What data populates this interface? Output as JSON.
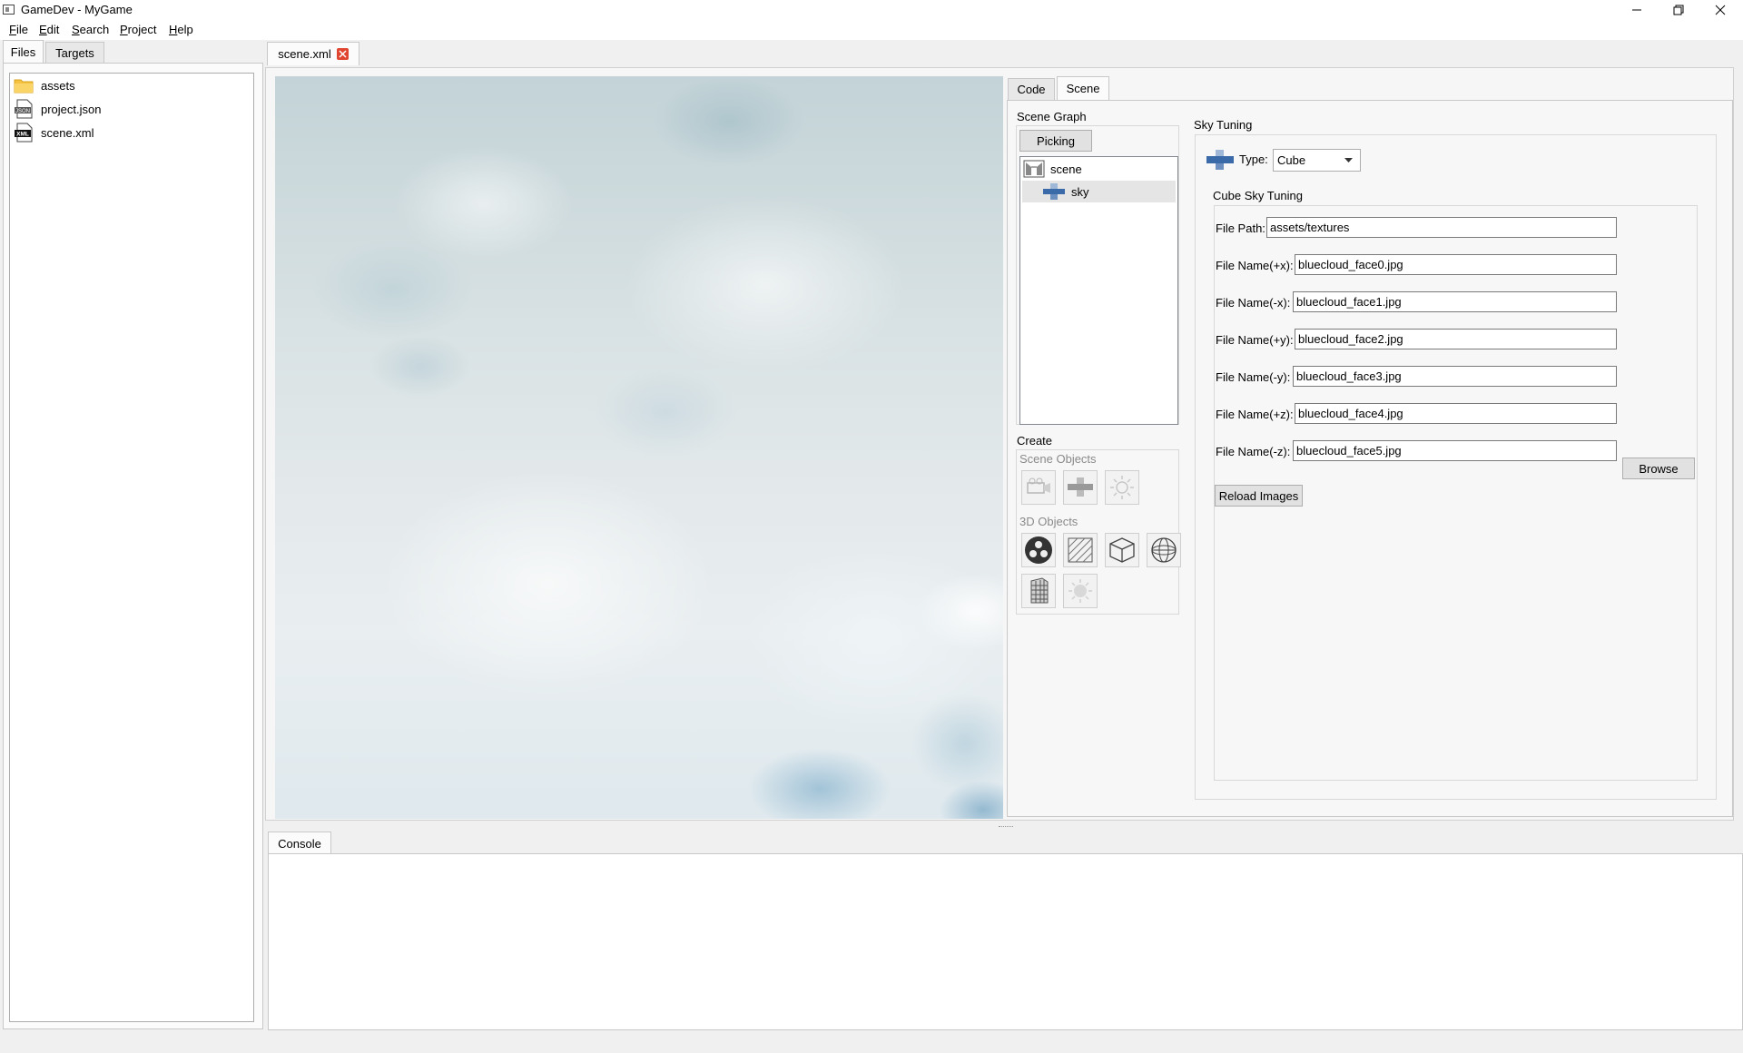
{
  "window": {
    "title": "GameDev - MyGame",
    "controls": {
      "minimize": "minimize",
      "maximize": "restore",
      "close": "close"
    }
  },
  "menubar": {
    "items": [
      {
        "label": "File",
        "mnemonic": "F",
        "rest": "ile"
      },
      {
        "label": "Edit",
        "mnemonic": "E",
        "rest": "dit"
      },
      {
        "label": "Search",
        "mnemonic": "S",
        "rest": "earch"
      },
      {
        "label": "Project",
        "mnemonic": "P",
        "rest": "roject"
      },
      {
        "label": "Help",
        "mnemonic": "H",
        "rest": "elp"
      }
    ]
  },
  "left_panel": {
    "tabs": [
      {
        "label": "Files",
        "active": true
      },
      {
        "label": "Targets",
        "active": false
      }
    ],
    "files": [
      {
        "name": "assets",
        "icon": "folder-icon"
      },
      {
        "name": "project.json",
        "icon": "json-file-icon",
        "badge": "JSON"
      },
      {
        "name": "scene.xml",
        "icon": "xml-file-icon",
        "badge": "XML"
      }
    ]
  },
  "editor": {
    "tab": {
      "label": "scene.xml",
      "close_icon": "close-tab-icon"
    }
  },
  "scene_panel": {
    "tabs": [
      {
        "label": "Code",
        "active": false
      },
      {
        "label": "Scene",
        "active": true
      }
    ],
    "scene_graph": {
      "title": "Scene Graph",
      "picking_button": "Picking",
      "nodes": [
        {
          "label": "scene",
          "icon": "scene-node-icon",
          "depth": 0,
          "selected": false
        },
        {
          "label": "sky",
          "icon": "sky-node-icon",
          "depth": 1,
          "selected": true
        }
      ]
    },
    "create": {
      "title": "Create",
      "scene_objects_title": "Scene Objects",
      "scene_objects": [
        "camera-icon",
        "sky-icon",
        "light-icon"
      ],
      "objects_3d_title": "3D Objects",
      "objects_3d": [
        "particles-icon",
        "plane-icon",
        "cube-icon",
        "sphere-icon",
        "building-icon",
        "glow-light-icon"
      ]
    },
    "sky_tuning": {
      "title": "Sky Tuning",
      "type_label": "Type:",
      "type_value": "Cube",
      "cube_title": "Cube Sky Tuning",
      "file_path_label": "File Path:",
      "file_path_value": "assets/textures",
      "faces": [
        {
          "label": "File Name(+x):",
          "value": "bluecloud_face0.jpg"
        },
        {
          "label": "File Name(-x):",
          "value": "bluecloud_face1.jpg"
        },
        {
          "label": "File Name(+y):",
          "value": "bluecloud_face2.jpg"
        },
        {
          "label": "File Name(-y):",
          "value": "bluecloud_face3.jpg"
        },
        {
          "label": "File Name(+z):",
          "value": "bluecloud_face4.jpg"
        },
        {
          "label": "File Name(-z):",
          "value": "bluecloud_face5.jpg"
        }
      ],
      "browse_button": "Browse",
      "reload_button": "Reload Images"
    }
  },
  "console": {
    "tab": "Console"
  },
  "colors": {
    "accent_close": "#e0462f",
    "selection": "#e5e5e5",
    "sky_blue": "#3b6aa8"
  }
}
